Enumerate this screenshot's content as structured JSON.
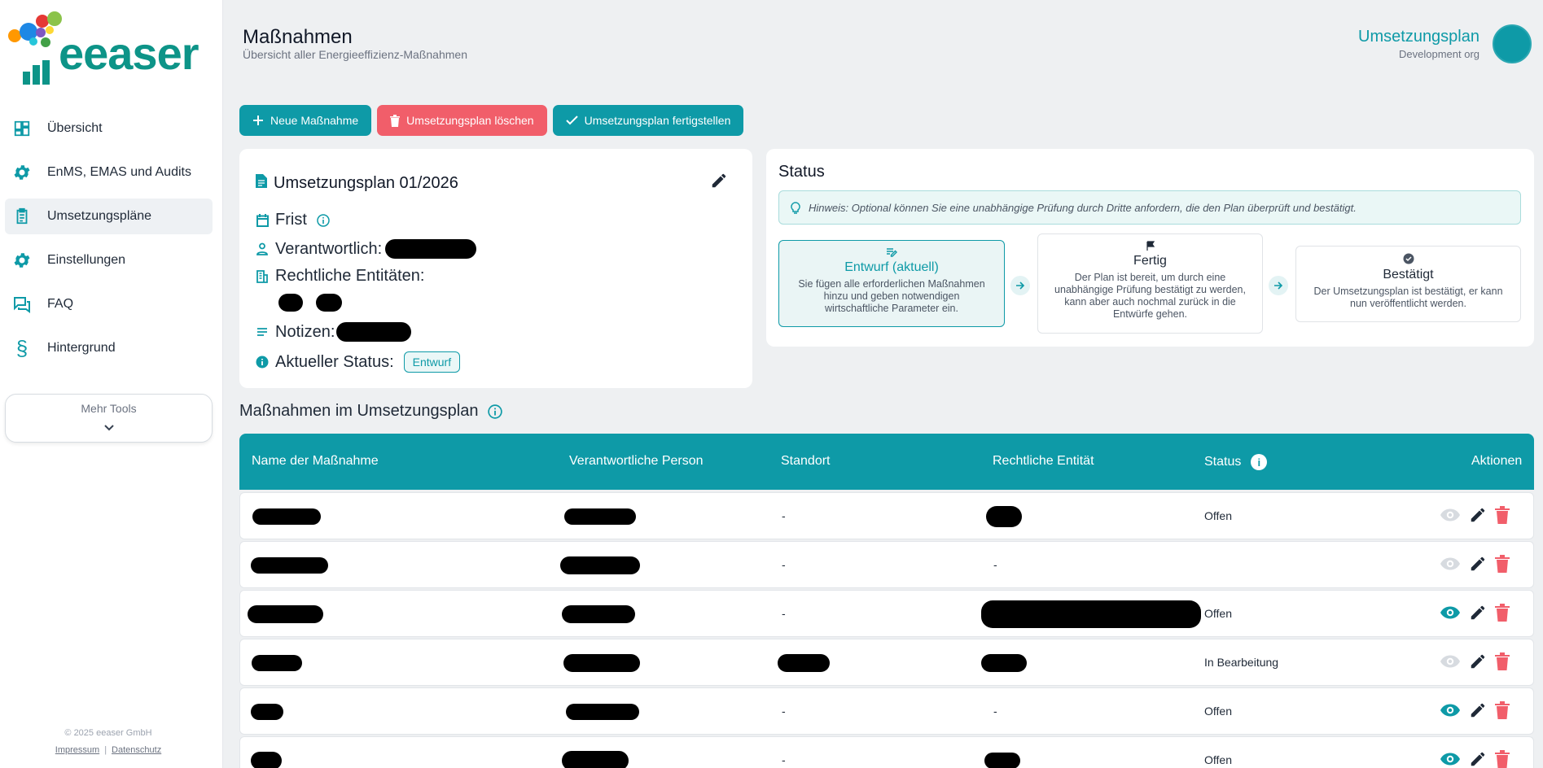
{
  "brand": {
    "logo_text": "eeaser",
    "accent": "#0e9aa7",
    "danger": "#f15e6a"
  },
  "sidebar": {
    "items": [
      {
        "label": "Übersicht",
        "icon": "dashboard-icon"
      },
      {
        "label": "EnMS, EMAS und Audits",
        "icon": "gear-icon"
      },
      {
        "label": "Umsetzungspläne",
        "icon": "clipboard-icon",
        "active": true
      },
      {
        "label": "Einstellungen",
        "icon": "gear-icon"
      },
      {
        "label": "FAQ",
        "icon": "chat-icon"
      },
      {
        "label": "Hintergrund",
        "icon": "section-sign-icon"
      }
    ],
    "more_tools": "Mehr Tools",
    "footer": {
      "copyright": "© 2025 eeaser GmbH",
      "impressum": "Impressum",
      "datenschutz": "Datenschutz"
    }
  },
  "header": {
    "title": "Maßnahmen",
    "subtitle": "Übersicht aller Energieeffizienz-Maßnahmen",
    "context_title": "Umsetzungsplan",
    "org": "Development org"
  },
  "toolbar": {
    "new_label": "Neue Maßnahme",
    "delete_label": "Umsetzungsplan löschen",
    "finish_label": "Umsetzungsplan fertigstellen"
  },
  "plan": {
    "title": "Umsetzungsplan 01/2026",
    "deadline_label": "Frist",
    "responsible_label": "Verantwortlich:",
    "entities_label": "Rechtliche Entitäten:",
    "notes_label": "Notizen:",
    "status_label": "Aktueller Status:",
    "status_badge": "Entwurf"
  },
  "status": {
    "title": "Status",
    "hint": "Hinweis: Optional können Sie eine unabhängige Prüfung durch Dritte anfordern, die den Plan überprüft und bestätigt.",
    "steps": [
      {
        "name": "Entwurf (aktuell)",
        "desc": "Sie fügen alle erforderlichen Maßnahmen hinzu und geben notwendigen wirtschaftliche Parameter ein."
      },
      {
        "name": "Fertig",
        "desc": "Der Plan ist bereit, um durch eine unabhängige Prüfung bestätigt zu werden, kann aber auch nochmal zurück in die Entwürfe gehen."
      },
      {
        "name": "Bestätigt",
        "desc": "Der Umsetzungsplan ist bestätigt, er kann nun veröffentlicht werden."
      }
    ]
  },
  "measures": {
    "title": "Maßnahmen im Umsetzungsplan",
    "columns": [
      "Name der Maßnahme",
      "Verantwortliche Person",
      "Standort",
      "Rechtliche Entität",
      "Status",
      "Aktionen"
    ],
    "rows": [
      {
        "standort": "-",
        "entitaet": "",
        "status": "Offen",
        "view_enabled": false
      },
      {
        "standort": "-",
        "entitaet": "-",
        "status": "",
        "view_enabled": false
      },
      {
        "standort": "-",
        "entitaet": "",
        "status": "Offen",
        "view_enabled": true
      },
      {
        "standort": "",
        "entitaet": "",
        "status": "In Bearbeitung",
        "view_enabled": false
      },
      {
        "standort": "-",
        "entitaet": "-",
        "status": "Offen",
        "view_enabled": true
      },
      {
        "standort": "-",
        "entitaet": "",
        "status": "Offen",
        "view_enabled": true
      }
    ]
  }
}
